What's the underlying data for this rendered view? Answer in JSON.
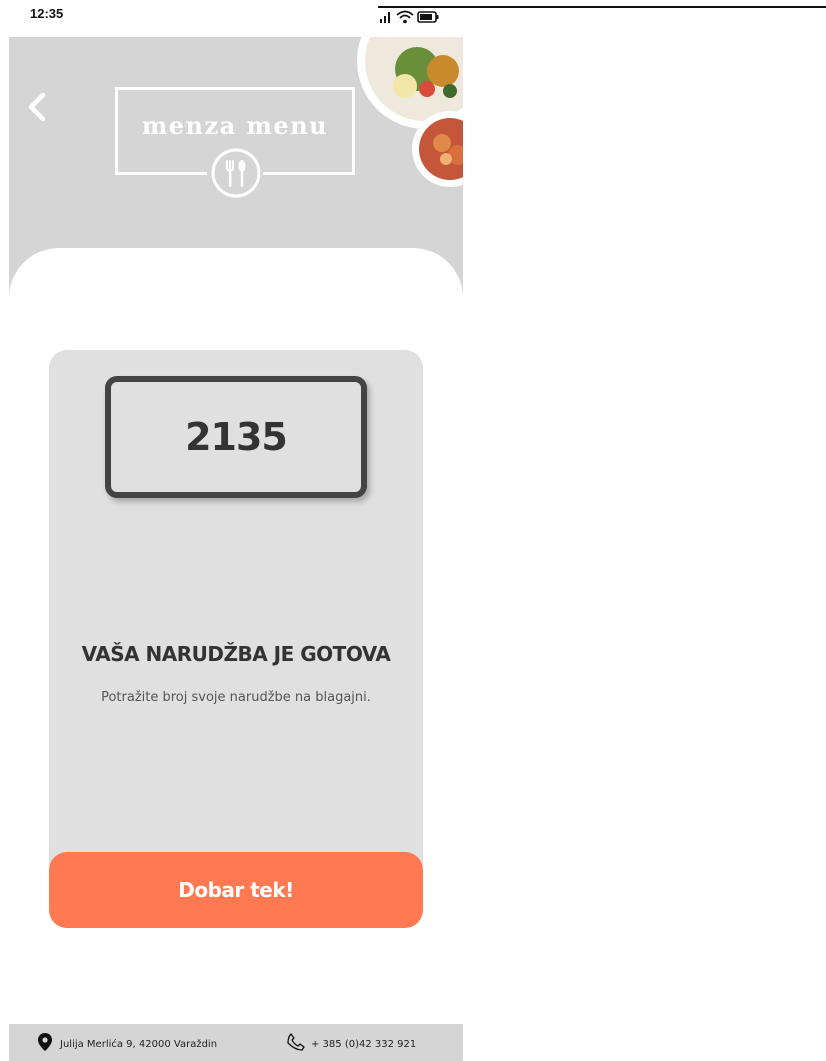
{
  "status_bar": {
    "time": "12:35",
    "icons": [
      "signal-icon",
      "wifi-icon",
      "battery-icon"
    ],
    "battery_level": "59"
  },
  "header": {
    "logo_text": "menza menu",
    "logo_icon": "cutlery-icon",
    "back_icon": "chevron-left-icon"
  },
  "order": {
    "number": "2135",
    "status_title": "VAŠA NARUDŽBA JE GOTOVA",
    "status_subtitle": "Potražite broj svoje narudžbe na blagajni."
  },
  "cta": {
    "label": "Dobar tek!"
  },
  "footer": {
    "address": "Julija Merlića 9, 42000 Varaždin",
    "phone": "+ 385 (0)42 332 921"
  },
  "colors": {
    "header_bg": "#d5d5d5",
    "card_bg": "#e0e0e0",
    "accent": "#ff7a52",
    "text_dark": "#333333"
  }
}
